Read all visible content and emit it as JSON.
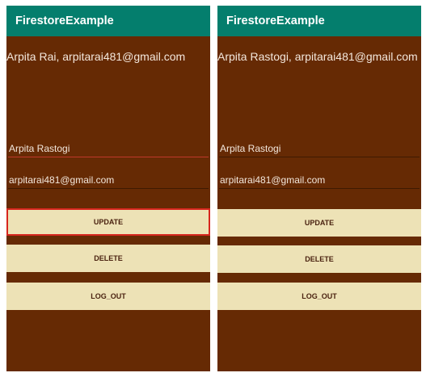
{
  "left": {
    "app_title": "FirestoreExample",
    "user_info": "Arpita Rai, arpitarai481@gmail.com",
    "name_value": "Arpita Rastogi",
    "email_value": "arpitarai481@gmail.com",
    "update_label": "UPDATE",
    "delete_label": "DELETE",
    "logout_label": "LOG_OUT"
  },
  "right": {
    "app_title": "FirestoreExample",
    "user_info": "Arpita Rastogi, arpitarai481@gmail.com",
    "name_value": "Arpita Rastogi",
    "email_value": "arpitarai481@gmail.com",
    "update_label": "UPDATE",
    "delete_label": "DELETE",
    "logout_label": "LOG_OUT"
  },
  "colors": {
    "app_bar": "#047e6d",
    "background": "#662a04",
    "button": "#ede2b6",
    "highlight": "#d7261e"
  }
}
